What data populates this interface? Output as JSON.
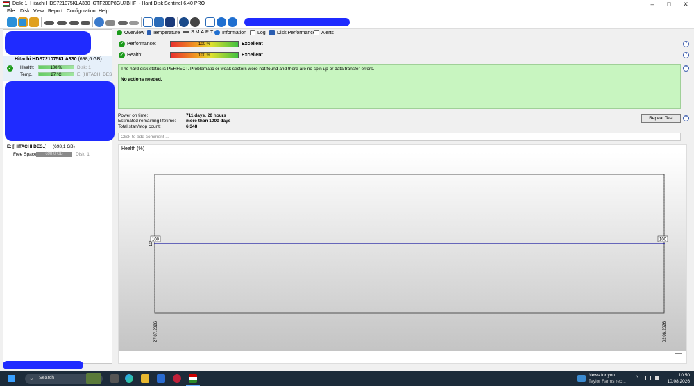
{
  "window": {
    "title": "Disk: 1, Hitachi HDS721075KLA330 [GTF200P8GU7BHF]  -  Hard Disk Sentinel 6.40 PRO",
    "minimize": "–",
    "maximize": "□",
    "close": "✕"
  },
  "menu": [
    "File",
    "Disk",
    "View",
    "Report",
    "Configuration",
    "Help"
  ],
  "left_panel": {
    "disk1": {
      "name": "Hitachi HDS721075KLA330",
      "size": "(698,6 GB)",
      "health_label": "Health:",
      "health_value": "100 %",
      "health_pct": 100,
      "disk_ref": "Disk: 1",
      "temp_label": "Temp.:",
      "temp_value": "27 °C",
      "volume_ref": "E: [HITACHI DESKST"
    },
    "volume": {
      "name": "E: [HITACHI DES..]",
      "size": "(698,1 GB)",
      "free_label": "Free Space",
      "free_value": "698,0 GB",
      "disk_ref": "Disk: 1"
    }
  },
  "tabs": [
    "Overview",
    "Temperature",
    "S.M.A.R.T.",
    "Information",
    "Log",
    "Disk Performance",
    "Alerts"
  ],
  "overview": {
    "performance_label": "Performance:",
    "performance_value": "100 %",
    "performance_pct": 100,
    "performance_rating": "Excellent",
    "health_label": "Health:",
    "health_value": "100 %",
    "health_pct": 100,
    "health_rating": "Excellent",
    "status_text": "The hard disk status is PERFECT. Problematic or weak sectors were not found and there are no spin up or data transfer errors.",
    "action_text": "No actions needed.",
    "power_on_label": "Power on time:",
    "power_on_value": "711 days, 20 hours",
    "lifetime_label": "Estimated remaining lifetime:",
    "lifetime_value": "more than 1000 days",
    "startstop_label": "Total start/stop count:",
    "startstop_value": "6,348",
    "repeat_button": "Repeat Test",
    "comment_placeholder": "Click to add comment ..."
  },
  "chart_data": {
    "type": "line",
    "title": "Health (%)",
    "x": [
      "27.07.2026",
      "02.08.2026"
    ],
    "series": [
      {
        "values": [
          100,
          100
        ]
      }
    ],
    "start_label": "100",
    "end_label": "100",
    "y_axis_label": "100",
    "color": "#1a1aa0"
  },
  "taskbar": {
    "search_placeholder": "Search",
    "news_title": "News for you",
    "news_sub": "Taylor Farms rec...",
    "time": "10:50",
    "date": "10.08.2026",
    "tray_chevron": "^"
  },
  "colors": {
    "status_bg": "#c8f5c0",
    "redaction": "#1f2bff",
    "taskbar": "#1c2b3a"
  }
}
